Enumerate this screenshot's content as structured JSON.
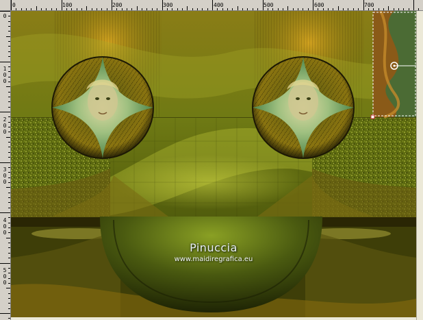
{
  "rulers": {
    "horizontal_labels": [
      "0",
      "100",
      "200",
      "300",
      "400",
      "500",
      "600",
      "700"
    ],
    "vertical_labels": [
      "0",
      "100",
      "200",
      "300",
      "400",
      "500"
    ]
  },
  "canvas": {
    "watermark_title": "Pinuccia",
    "watermark_url": "www.maidiregrafica.eu"
  },
  "colors": {
    "ruler_bg": "#d4d0c8",
    "canvas_dark": "#3a3a08",
    "canvas_olive": "#7a7a18",
    "canvas_gold": "#b8860b",
    "selection": "#ffffff"
  },
  "icons": {
    "pick_handle": "pick-handle-icon",
    "selection_node": "selection-node-icon"
  }
}
